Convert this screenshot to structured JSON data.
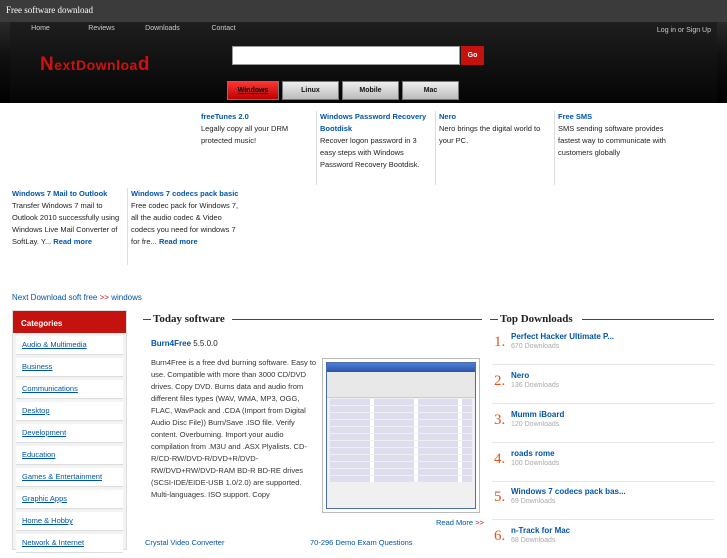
{
  "topbar": {
    "title": "Free software download"
  },
  "nav": {
    "items": [
      "Home",
      "Reviews",
      "Downloads",
      "Contact"
    ],
    "login": "Log in or Sign Up"
  },
  "logo": {
    "first": "N",
    "rest": "extDownloa",
    "last": "d"
  },
  "search": {
    "value": "",
    "go": "Go"
  },
  "platform_tabs": [
    "Windows",
    "Linux",
    "Mobile",
    "Mac"
  ],
  "featured": [
    {
      "title": "freeTunes 2.0",
      "desc": "Legally copy all your DRM protected music!"
    },
    {
      "title": "Windows Password Recovery Bootdisk",
      "desc": "Recover logon password in 3 easy steps with Windows Password Recovery Bootdisk."
    },
    {
      "title": "Nero",
      "desc": "Nero brings the digital world to your PC."
    },
    {
      "title": "Free SMS",
      "desc": "SMS sending software provides fastest way to communicate with customers globally"
    },
    {
      "title": "Windows 7 Mail to Outlook",
      "desc": "Transfer Windows 7 mail to Outlook 2010 successfully using Windows Live Mail Converter of SoftLay. Y...",
      "more": "Read more"
    },
    {
      "title": "Windows 7 codecs pack basic",
      "desc": "Free codec pack for Windows 7, all the audio codec & Video codecs you need for windows 7 for fre...",
      "more": "Read more"
    }
  ],
  "breadcrumb": {
    "home": "Next Download soft free",
    "sep": ">>",
    "current": "windows"
  },
  "categories": {
    "title": "Categories",
    "items": [
      "Audio & Multimedia",
      "Business",
      "Communications",
      "Desktop",
      "Development",
      "Education",
      "Games & Entertainment",
      "Graphic Apps",
      "Home & Hobby",
      "Network & Internet"
    ]
  },
  "today": {
    "heading": "Today software",
    "name": "Burn4Free",
    "version": "5.5.0.0",
    "desc": "Burn4Free is a free dvd burning software. Easy to use. Compatible with more than 3000 CD/DVD drives. Copy DVD. Burns data and audio from different files types (WAV, WMA, MP3, OGG, FLAC, WavPack and .CDA (Import from Digital Audio Disc File)) Burn/Save .ISO file. Verify content. Overburning. Import your audio compilation from .M3U and .ASX Plyalists. CD-R/CD-RW/DVD-R/DVD+R/DVD-RW/DVD+RW/DVD-RAM BD-R BD-RE drives (SCSI-IDE/EIDE-USB 1.0/2.0) are supported. Multi-languages. ISO support. Copy",
    "read_more": "Read More",
    "read_more_arrow": ">>",
    "bottom_links": [
      "Crystal Video Converter",
      "70-296 Demo Exam Questions"
    ]
  },
  "top_downloads": {
    "heading": "Top Downloads",
    "items": [
      {
        "rank": "1.",
        "name": "Perfect Hacker Ultimate P...",
        "count": "670 Downloads"
      },
      {
        "rank": "2.",
        "name": "Nero",
        "count": "136 Downloads"
      },
      {
        "rank": "3.",
        "name": "Mumm iBoard",
        "count": "120 Downloads"
      },
      {
        "rank": "4.",
        "name": "roads rome",
        "count": "100 Downloads"
      },
      {
        "rank": "5.",
        "name": "Windows 7 codecs pack bas...",
        "count": "69 Downloads"
      },
      {
        "rank": "6.",
        "name": "n-Track for Mac",
        "count": "68 Downloads"
      }
    ]
  },
  "colors": {
    "brand_red": "#c4120f",
    "link_blue": "#0055aa",
    "rank_orange": "#e2541a"
  }
}
